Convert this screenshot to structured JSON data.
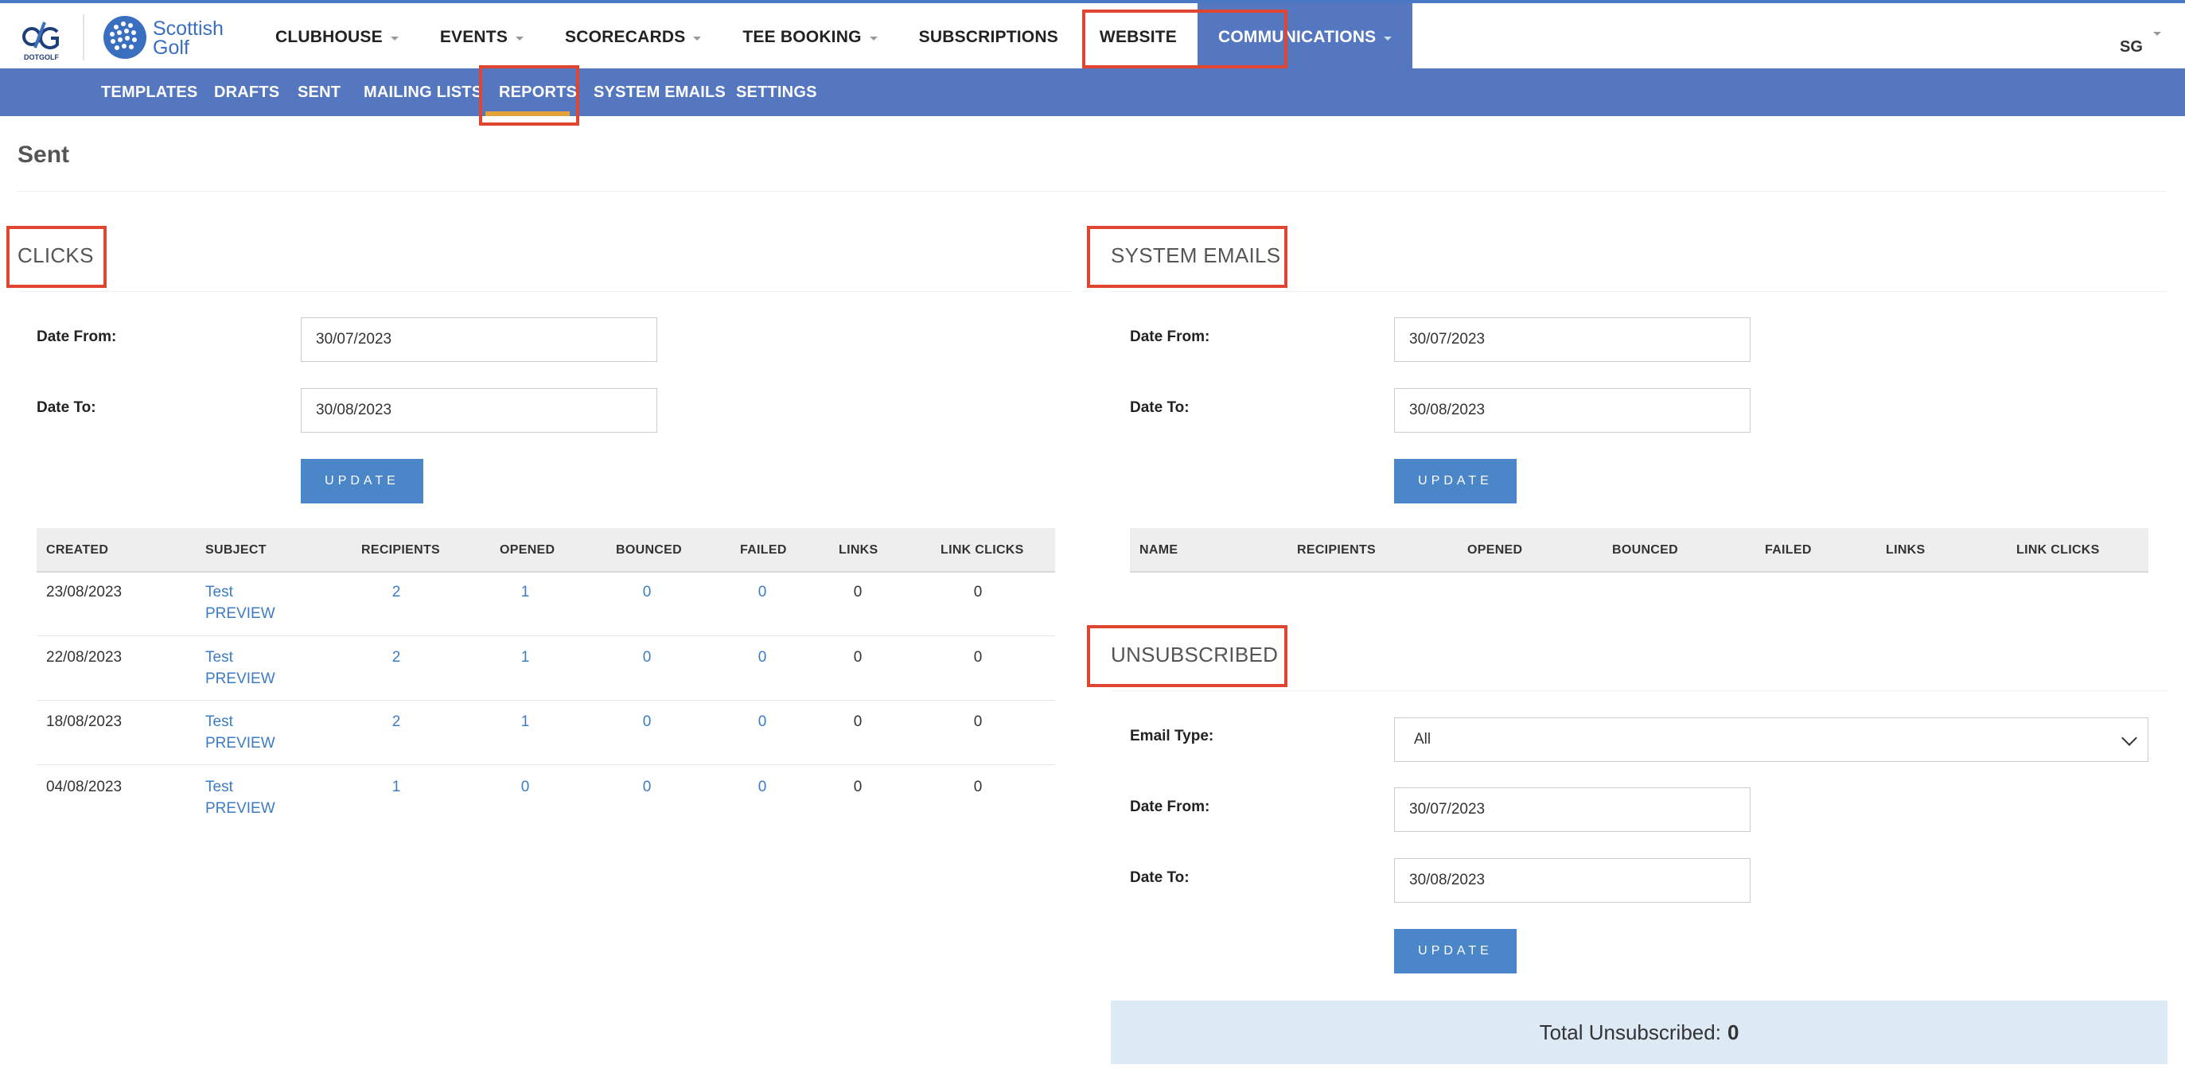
{
  "brand": {
    "dg_logo_text": "DOTGOLF",
    "sg_logo_line1": "Scottish",
    "sg_logo_line2": "Golf"
  },
  "main_nav": [
    {
      "label": "CLUBHOUSE",
      "has_dropdown": true
    },
    {
      "label": "EVENTS",
      "has_dropdown": true
    },
    {
      "label": "SCORECARDS",
      "has_dropdown": true
    },
    {
      "label": "TEE BOOKING",
      "has_dropdown": true
    },
    {
      "label": "SUBSCRIPTIONS",
      "has_dropdown": false
    },
    {
      "label": "WEBSITE",
      "has_dropdown": false
    },
    {
      "label": "COMMUNICATIONS",
      "has_dropdown": true,
      "active": true
    }
  ],
  "user": {
    "initials": "SG"
  },
  "sub_nav": [
    {
      "label": "TEMPLATES"
    },
    {
      "label": "DRAFTS"
    },
    {
      "label": "SENT"
    },
    {
      "label": "MAILING LISTS"
    },
    {
      "label": "REPORTS",
      "active": true
    },
    {
      "label": "SYSTEM EMAILS"
    },
    {
      "label": "SETTINGS"
    }
  ],
  "page_title": "Sent",
  "clicks": {
    "title": "CLICKS",
    "date_from_label": "Date From:",
    "date_from": "30/07/2023",
    "date_to_label": "Date To:",
    "date_to": "30/08/2023",
    "update_label": "UPDATE",
    "columns": [
      "CREATED",
      "SUBJECT",
      "RECIPIENTS",
      "OPENED",
      "BOUNCED",
      "FAILED",
      "LINKS",
      "LINK CLICKS"
    ],
    "rows": [
      {
        "created": "23/08/2023",
        "subject": "Test",
        "preview": "PREVIEW",
        "recipients": "2",
        "opened": "1",
        "bounced": "0",
        "failed": "0",
        "links": "0",
        "link_clicks": "0"
      },
      {
        "created": "22/08/2023",
        "subject": "Test",
        "preview": "PREVIEW",
        "recipients": "2",
        "opened": "1",
        "bounced": "0",
        "failed": "0",
        "links": "0",
        "link_clicks": "0"
      },
      {
        "created": "18/08/2023",
        "subject": "Test",
        "preview": "PREVIEW",
        "recipients": "2",
        "opened": "1",
        "bounced": "0",
        "failed": "0",
        "links": "0",
        "link_clicks": "0"
      },
      {
        "created": "04/08/2023",
        "subject": "Test",
        "preview": "PREVIEW",
        "recipients": "1",
        "opened": "0",
        "bounced": "0",
        "failed": "0",
        "links": "0",
        "link_clicks": "0"
      }
    ]
  },
  "system_emails": {
    "title": "SYSTEM EMAILS",
    "date_from_label": "Date From:",
    "date_from": "30/07/2023",
    "date_to_label": "Date To:",
    "date_to": "30/08/2023",
    "update_label": "UPDATE",
    "columns": [
      "NAME",
      "RECIPIENTS",
      "OPENED",
      "BOUNCED",
      "FAILED",
      "LINKS",
      "LINK CLICKS"
    ]
  },
  "unsubscribed": {
    "title": "UNSUBSCRIBED",
    "email_type_label": "Email Type:",
    "email_type": "All",
    "date_from_label": "Date From:",
    "date_from": "30/07/2023",
    "date_to_label": "Date To:",
    "date_to": "30/08/2023",
    "update_label": "UPDATE",
    "total_label": "Total Unsubscribed:",
    "total_value": "0"
  },
  "colors": {
    "nav_blue": "#5577bf",
    "button_blue": "#4a86c8",
    "link_blue": "#3b7cc4",
    "highlight_red": "#e0452f",
    "total_box_bg": "#dde9f5"
  }
}
